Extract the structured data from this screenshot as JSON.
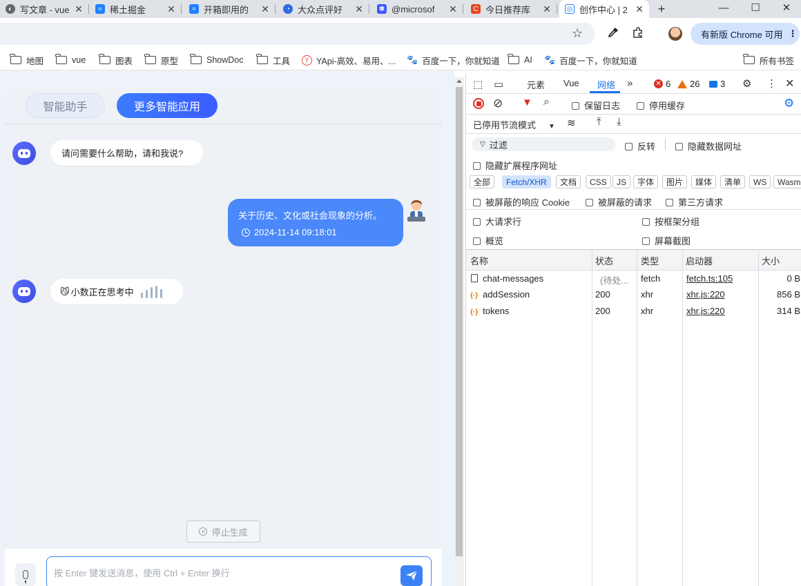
{
  "browser": {
    "tabs": [
      {
        "title": "写文章 - vue",
        "icon_color": "#555555",
        "icon": "W",
        "active": false
      },
      {
        "title": "稀土掘金",
        "icon_color": "#1e80ff",
        "icon": "≈",
        "active": false
      },
      {
        "title": "开箱即用的",
        "icon_color": "#1e80ff",
        "icon": "≈",
        "active": false
      },
      {
        "title": "大众点评好",
        "icon_color": "#2f6ae0",
        "icon": "G",
        "active": false
      },
      {
        "title": "@microsof",
        "icon_color": "#3d5afe",
        "icon": "🐾",
        "active": false
      },
      {
        "title": "今日推荐库",
        "icon_color": "#e8471d",
        "icon": "C",
        "active": false
      },
      {
        "title": "创作中心 | 2",
        "icon_color": "#1e80ff",
        "icon": "◎",
        "active": true
      }
    ],
    "new_tab": "+",
    "window_controls": {
      "minimize": "—",
      "maximize": "☐",
      "close": "✕"
    },
    "update_button": "有新版 Chrome 可用",
    "bookmarks": [
      {
        "label": "地图",
        "type": "folder"
      },
      {
        "label": "vue",
        "type": "folder"
      },
      {
        "label": "图表",
        "type": "folder"
      },
      {
        "label": "原型",
        "type": "folder"
      },
      {
        "label": "ShowDoc",
        "type": "folder"
      },
      {
        "label": "工具",
        "type": "folder"
      },
      {
        "label": "YApi-高效、易用、...",
        "type": "yapi"
      },
      {
        "label": "百度一下，你就知道",
        "type": "baidu"
      },
      {
        "label": "AI",
        "type": "folder"
      },
      {
        "label": "百度一下，你就知道",
        "type": "baidu"
      },
      {
        "label": "所有书签",
        "type": "folder"
      }
    ]
  },
  "chat": {
    "tab_assistant": "智能助手",
    "tab_more_apps": "更多智能应用",
    "bot_greeting": "请问需要什么帮助，请和我说?",
    "user_message": "关于历史、文化或社会现象的分析。",
    "user_message_time": "2024-11-14 09:18:01",
    "thinking_text": "小数正在思考中",
    "stop_button": "停止生成",
    "input_placeholder": "按 Enter 键发送消息，使用 Ctrl + Enter 换行",
    "accent_color": "#3b82f6"
  },
  "devtools": {
    "tabs": [
      "元素",
      "Vue",
      "网络"
    ],
    "active_tab": "网络",
    "errors": "6",
    "warnings": "26",
    "messages": "3",
    "preserve_log": "保留日志",
    "disable_cache": "停用缓存",
    "throttling": "已停用节流模式",
    "filter_placeholder": "过滤",
    "invert": "反转",
    "hide_data_urls": "隐藏数据网址",
    "hide_extension_urls": "隐藏扩展程序网址",
    "type_filters": [
      "全部",
      "Fetch/XHR",
      "文档",
      "CSS",
      "JS",
      "字体",
      "图片",
      "媒体",
      "清单",
      "WS",
      "Wasm"
    ],
    "selected_filter": "Fetch/XHR",
    "blocked_cookies": "被屏蔽的响应 Cookie",
    "blocked_requests": "被屏蔽的请求",
    "third_party": "第三方请求",
    "large_rows": "大请求行",
    "group_by_frame": "按框架分组",
    "overview": "概览",
    "screenshots": "屏幕截图",
    "columns": [
      "名称",
      "状态",
      "类型",
      "启动器",
      "大小"
    ],
    "requests": [
      {
        "name": "chat-messages",
        "status": "(待处...",
        "type": "fetch",
        "initiator": "fetch.ts:105",
        "size": "0 B",
        "icon": "doc"
      },
      {
        "name": "addSession",
        "status": "200",
        "type": "xhr",
        "initiator": "xhr.js:220",
        "size": "856 B",
        "icon": "xhr"
      },
      {
        "name": "tokens",
        "status": "200",
        "type": "xhr",
        "initiator": "xhr.js:220",
        "size": "314 B",
        "icon": "xhr"
      }
    ]
  }
}
